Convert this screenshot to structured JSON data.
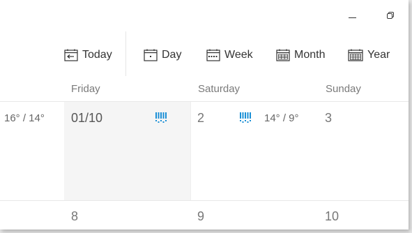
{
  "window": {
    "controls": [
      "minimize",
      "restore"
    ]
  },
  "toolbar": {
    "today_label": "Today",
    "day_label": "Day",
    "week_label": "Week",
    "month_label": "Month",
    "year_label": "Year",
    "more_label": "·"
  },
  "week_header": {
    "days": [
      "Friday",
      "Saturday",
      "Sunday"
    ]
  },
  "week1": {
    "prev_temp": "16° / 14°",
    "friday_date": "01/10",
    "saturday_date": "2",
    "saturday_temp": "14° / 9°",
    "sunday_date": "3",
    "weather_icon": "rain-icon",
    "weather_icon_color": "#1a8fd6"
  },
  "week2": {
    "friday_date": "8",
    "saturday_date": "9",
    "sunday_date": "10"
  }
}
